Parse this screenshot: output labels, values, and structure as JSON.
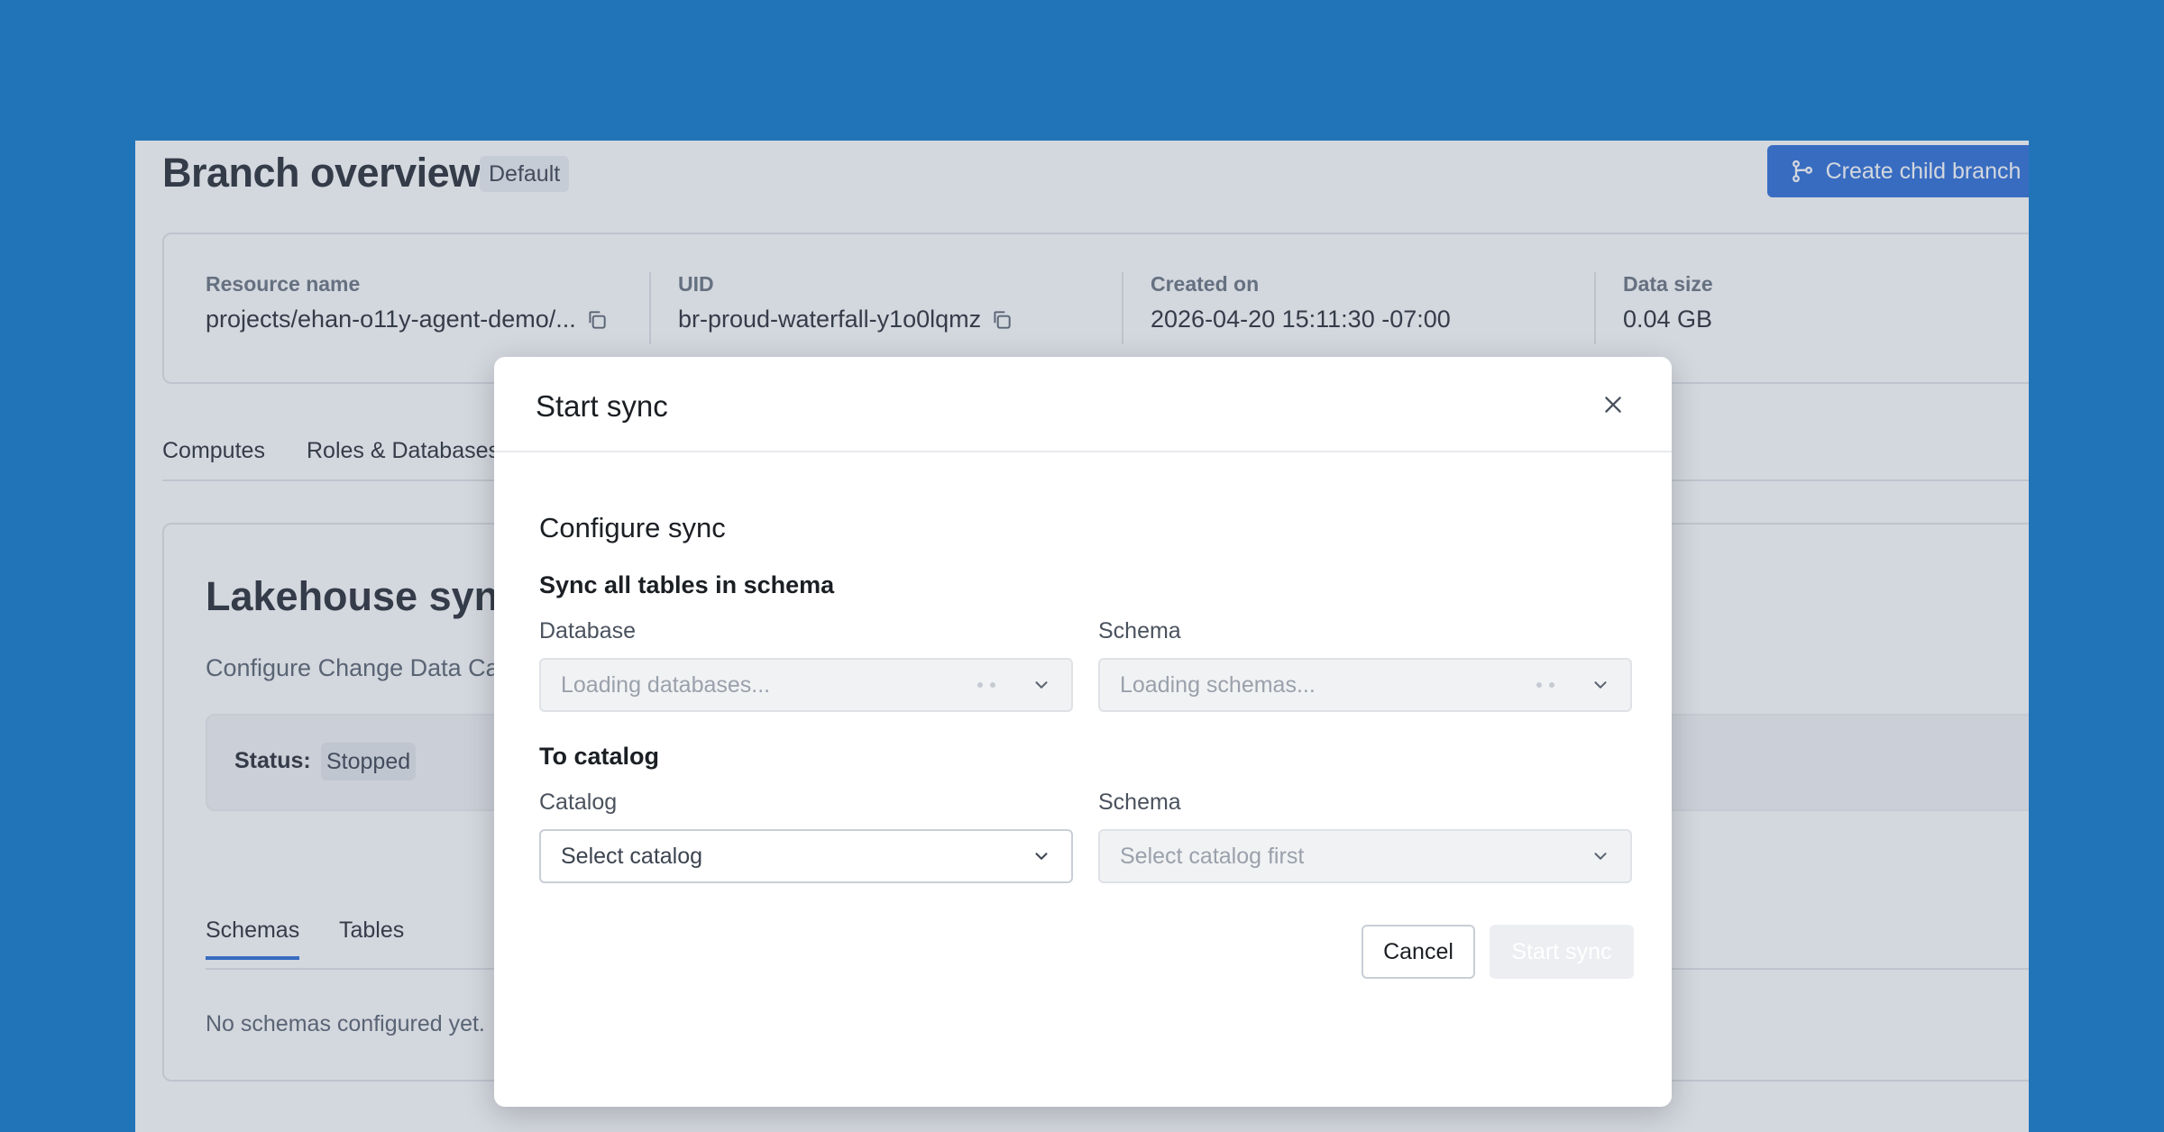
{
  "page": {
    "title": "Branch overview",
    "badge": "Default",
    "create_branch_label": "Create child branch"
  },
  "info": [
    {
      "label": "Resource name",
      "value": "projects/ehan-o11y-agent-demo/..."
    },
    {
      "label": "UID",
      "value": "br-proud-waterfall-y1o0lqmz"
    },
    {
      "label": "Created on",
      "value": "2026-04-20 15:11:30 -07:00"
    },
    {
      "label": "Data size",
      "value": "0.04 GB"
    }
  ],
  "tabs": [
    "Computes",
    "Roles & Databases"
  ],
  "sync": {
    "title": "Lakehouse sync",
    "description": "Configure Change Data Ca",
    "status_label": "Status:",
    "status_value": "Stopped",
    "subtabs": [
      "Schemas",
      "Tables"
    ],
    "empty": "No schemas configured yet."
  },
  "modal": {
    "title": "Start sync",
    "section_title": "Configure sync",
    "source_title": "Sync all tables in schema",
    "database_label": "Database",
    "database_placeholder": "Loading databases...",
    "source_schema_label": "Schema",
    "source_schema_placeholder": "Loading schemas...",
    "target_title": "To catalog",
    "catalog_label": "Catalog",
    "catalog_placeholder": "Select catalog",
    "target_schema_label": "Schema",
    "target_schema_placeholder": "Select catalog first",
    "cancel_label": "Cancel",
    "submit_label": "Start sync"
  },
  "colors": {
    "background": "#2274B8",
    "primary": "#2E6FD8",
    "overlay": "rgba(84,100,126,0.26)"
  },
  "icons": {
    "copy": "copy-icon",
    "close": "close-icon",
    "chevron": "chevron-down-icon",
    "branch": "branch-icon"
  }
}
